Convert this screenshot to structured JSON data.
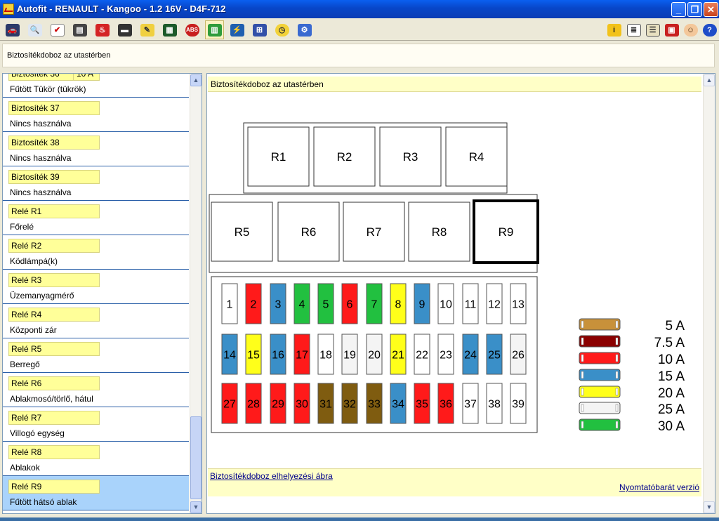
{
  "window": {
    "title": "Autofit - RENAULT - Kangoo - 1.2 16V - D4F-712",
    "buttons": {
      "minimize": "_",
      "maximize": "❐",
      "close": "✕"
    }
  },
  "toolbar": {
    "left_icons": [
      "car-icon",
      "inspect-icon",
      "checklist-icon",
      "parts-icon",
      "oil-can-icon",
      "gauge-icon",
      "pencil-icon",
      "circuit-board-icon",
      "abs-icon",
      "fuse-icon",
      "wiring-icon",
      "diagram-icon",
      "clock-icon",
      "settings-icon"
    ],
    "abs_label": "ABS",
    "right_icons": [
      "info-icon",
      "document-icon",
      "notes-icon",
      "calendar-icon",
      "user-icon",
      "help-icon"
    ],
    "active_index": 9
  },
  "pathbar": {
    "text": "Biztosítékdoboz az utastérben"
  },
  "list": {
    "items": [
      {
        "tag": "Biztosíték 36",
        "tag2": "10 A",
        "desc": "Fűtött Tükör (tükrök)"
      },
      {
        "tag": "Biztosíték 37",
        "desc": "Nincs használva"
      },
      {
        "tag": "Biztosíték 38",
        "desc": "Nincs használva"
      },
      {
        "tag": "Biztosíték 39",
        "desc": "Nincs használva"
      },
      {
        "tag": "Relé R1",
        "desc": "Főrelé"
      },
      {
        "tag": "Relé R2",
        "desc": "Ködlámpá(k)"
      },
      {
        "tag": "Relé R3",
        "desc": "Üzemanyagmérő"
      },
      {
        "tag": "Relé R4",
        "desc": "Központi zár"
      },
      {
        "tag": "Relé R5",
        "desc": "Berregő"
      },
      {
        "tag": "Relé R6",
        "desc": "Ablakmosó/törlő, hátul"
      },
      {
        "tag": "Relé R7",
        "desc": "Villogó egység"
      },
      {
        "tag": "Relé R8",
        "desc": "Ablakok"
      },
      {
        "tag": "Relé R9",
        "desc": "Fűtött hátsó ablak"
      }
    ],
    "selected_index": 12
  },
  "panel": {
    "title": "Biztosítékdoboz az utastérben",
    "link_location": "Biztosítékdoboz elhelyezési ábra",
    "link_print": "Nyomtatóbarát verzió"
  },
  "relays": [
    {
      "label": "R1",
      "row": 0
    },
    {
      "label": "R2",
      "row": 0
    },
    {
      "label": "R3",
      "row": 0
    },
    {
      "label": "R4",
      "row": 0
    },
    {
      "label": "R5",
      "row": 1
    },
    {
      "label": "R6",
      "row": 1
    },
    {
      "label": "R7",
      "row": 1
    },
    {
      "label": "R8",
      "row": 1
    },
    {
      "label": "R9",
      "row": 1,
      "selected": true
    }
  ],
  "fuse_colors": {
    "5 A": "#c8913a",
    "7.5 A": "#8b0000",
    "10 A": "#ff1a1a",
    "15 A": "#3a8fc8",
    "20 A": "#ffff1a",
    "25 A": "#f4f4f4",
    "30 A": "#22c040",
    "unused": "#ffffff",
    "brown": "#7f5c10"
  },
  "fuses": [
    {
      "n": "1",
      "rating": "unused"
    },
    {
      "n": "2",
      "rating": "10 A"
    },
    {
      "n": "3",
      "rating": "15 A"
    },
    {
      "n": "4",
      "rating": "30 A"
    },
    {
      "n": "5",
      "rating": "30 A"
    },
    {
      "n": "6",
      "rating": "10 A"
    },
    {
      "n": "7",
      "rating": "30 A"
    },
    {
      "n": "8",
      "rating": "20 A"
    },
    {
      "n": "9",
      "rating": "15 A"
    },
    {
      "n": "10",
      "rating": "unused"
    },
    {
      "n": "11",
      "rating": "unused"
    },
    {
      "n": "12",
      "rating": "unused"
    },
    {
      "n": "13",
      "rating": "unused"
    },
    {
      "n": "14",
      "rating": "15 A"
    },
    {
      "n": "15",
      "rating": "20 A"
    },
    {
      "n": "16",
      "rating": "15 A"
    },
    {
      "n": "17",
      "rating": "10 A"
    },
    {
      "n": "18",
      "rating": "unused"
    },
    {
      "n": "19",
      "rating": "25 A"
    },
    {
      "n": "20",
      "rating": "25 A"
    },
    {
      "n": "21",
      "rating": "20 A"
    },
    {
      "n": "22",
      "rating": "unused"
    },
    {
      "n": "23",
      "rating": "unused"
    },
    {
      "n": "24",
      "rating": "15 A"
    },
    {
      "n": "25",
      "rating": "15 A"
    },
    {
      "n": "26",
      "rating": "25 A"
    },
    {
      "n": "27",
      "rating": "10 A"
    },
    {
      "n": "28",
      "rating": "10 A"
    },
    {
      "n": "29",
      "rating": "10 A"
    },
    {
      "n": "30",
      "rating": "10 A"
    },
    {
      "n": "31",
      "rating": "brown"
    },
    {
      "n": "32",
      "rating": "brown"
    },
    {
      "n": "33",
      "rating": "brown"
    },
    {
      "n": "34",
      "rating": "15 A"
    },
    {
      "n": "35",
      "rating": "10 A"
    },
    {
      "n": "36",
      "rating": "10 A"
    },
    {
      "n": "37",
      "rating": "unused"
    },
    {
      "n": "38",
      "rating": "unused"
    },
    {
      "n": "39",
      "rating": "unused"
    }
  ],
  "legend": [
    {
      "label": "5 A",
      "color": "#c8913a"
    },
    {
      "label": "7.5 A",
      "color": "#8b0000"
    },
    {
      "label": "10 A",
      "color": "#ff1a1a"
    },
    {
      "label": "15 A",
      "color": "#3a8fc8"
    },
    {
      "label": "20 A",
      "color": "#ffff1a"
    },
    {
      "label": "25 A",
      "color": "#f4f4f4"
    },
    {
      "label": "30 A",
      "color": "#22c040"
    }
  ]
}
